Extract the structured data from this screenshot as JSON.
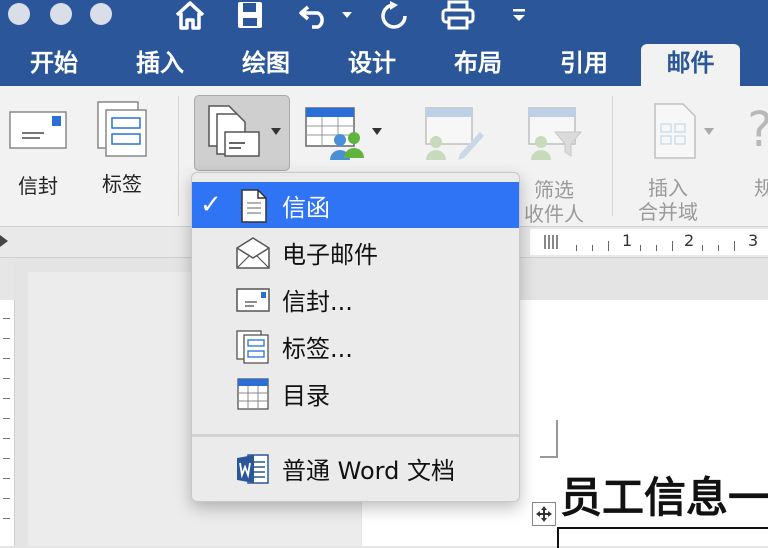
{
  "quick_access": {
    "icons": [
      "close-dot",
      "minimize-dot",
      "zoom-dot",
      "home-icon",
      "save-icon",
      "undo-icon",
      "redo-icon",
      "print-icon",
      "customize-icon"
    ]
  },
  "tabs": [
    "开始",
    "插入",
    "绘图",
    "设计",
    "布局",
    "引用",
    "邮件"
  ],
  "active_tab": "邮件",
  "ribbon": {
    "envelope_label": "信封",
    "labels_label": "标签",
    "filter_label_1": "筛选",
    "filter_label_2": "收件人",
    "insert_field_1": "插入",
    "insert_field_2": "合并域",
    "rules_partial": "规"
  },
  "ruler": {
    "numbers": [
      "1",
      "2",
      "3"
    ]
  },
  "menu": {
    "items": [
      {
        "label": "信函",
        "icon": "letter-icon",
        "checked": true
      },
      {
        "label": "电子邮件",
        "icon": "email-icon",
        "checked": false
      },
      {
        "label": "信封...",
        "icon": "envelope-icon",
        "checked": false
      },
      {
        "label": "标签...",
        "icon": "labels-icon",
        "checked": false
      },
      {
        "label": "目录",
        "icon": "directory-icon",
        "checked": false
      },
      {
        "label": "普通 Word 文档",
        "icon": "word-document-icon",
        "checked": false
      }
    ],
    "check_glyph": "✓"
  },
  "document": {
    "heading": "员工信息一"
  },
  "colors": {
    "brand": "#2b579a",
    "highlight": "#2f74f5",
    "ribbon_bg": "#f2f2f2"
  }
}
